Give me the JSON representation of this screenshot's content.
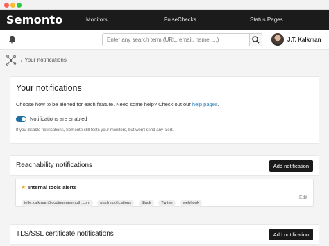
{
  "app": {
    "logo_text": "Semonto"
  },
  "nav": {
    "items": [
      {
        "label": "Monitors"
      },
      {
        "label": "PulseChecks"
      },
      {
        "label": "Status Pages"
      }
    ]
  },
  "header": {
    "search_placeholder": "Enter any search term (URL, email, name, ...)",
    "user_name": "J.T. Kalkman"
  },
  "breadcrumb": {
    "separator": "/",
    "current": "Your notifications"
  },
  "main": {
    "title": "Your notifications",
    "intro_text": "Choose how to be alerted for each feature. Need some help? Check out our",
    "intro_link": "help pages",
    "intro_end": ".",
    "toggle_label": "Notifications are enabled",
    "toggle_on": true,
    "hint": "If you disable notifications, Semonto still tests your monitors, but won't send any alert."
  },
  "reachability": {
    "title": "Reachability notifications",
    "add_label": "Add notification",
    "alerts": [
      {
        "name": "Internal tools alerts",
        "starred": true,
        "tags": [
          "jelle.kalkman@codingmammoth.com",
          "push notifications",
          "Slack",
          "Twitter",
          "webhook"
        ],
        "edit_label": "Edit"
      }
    ]
  },
  "ssl": {
    "title": "TLS/SSL certificate notifications",
    "add_label": "Add notification"
  },
  "colors": {
    "nav_bg": "#1b1b1b",
    "toggle": "#1d6fa5",
    "link": "#2a7fb8",
    "star": "#f0a020",
    "button_bg": "#1a1a1a"
  }
}
